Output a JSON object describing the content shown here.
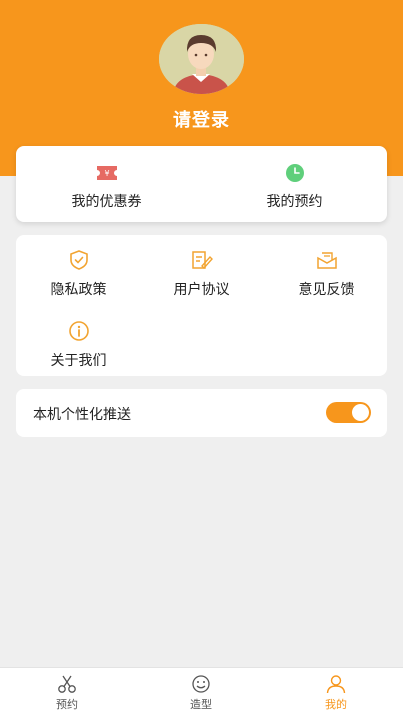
{
  "colors": {
    "accent": "#f7961c",
    "background": "#efefef"
  },
  "header": {
    "login_label": "请登录"
  },
  "top_card": {
    "items": [
      {
        "label": "我的优惠券",
        "icon": "coupon-icon"
      },
      {
        "label": "我的预约",
        "icon": "clock-icon"
      }
    ]
  },
  "menu": {
    "items": [
      {
        "label": "隐私政策",
        "icon": "shield-check-icon"
      },
      {
        "label": "用户协议",
        "icon": "document-edit-icon"
      },
      {
        "label": "意见反馈",
        "icon": "mail-icon"
      },
      {
        "label": "关于我们",
        "icon": "info-icon"
      }
    ]
  },
  "settings": {
    "push_label": "本机个性化推送",
    "push_enabled": true
  },
  "tabbar": {
    "tabs": [
      {
        "label": "预约",
        "icon": "scissors-icon",
        "active": false
      },
      {
        "label": "造型",
        "icon": "smile-icon",
        "active": false
      },
      {
        "label": "我的",
        "icon": "user-icon",
        "active": true
      }
    ]
  }
}
